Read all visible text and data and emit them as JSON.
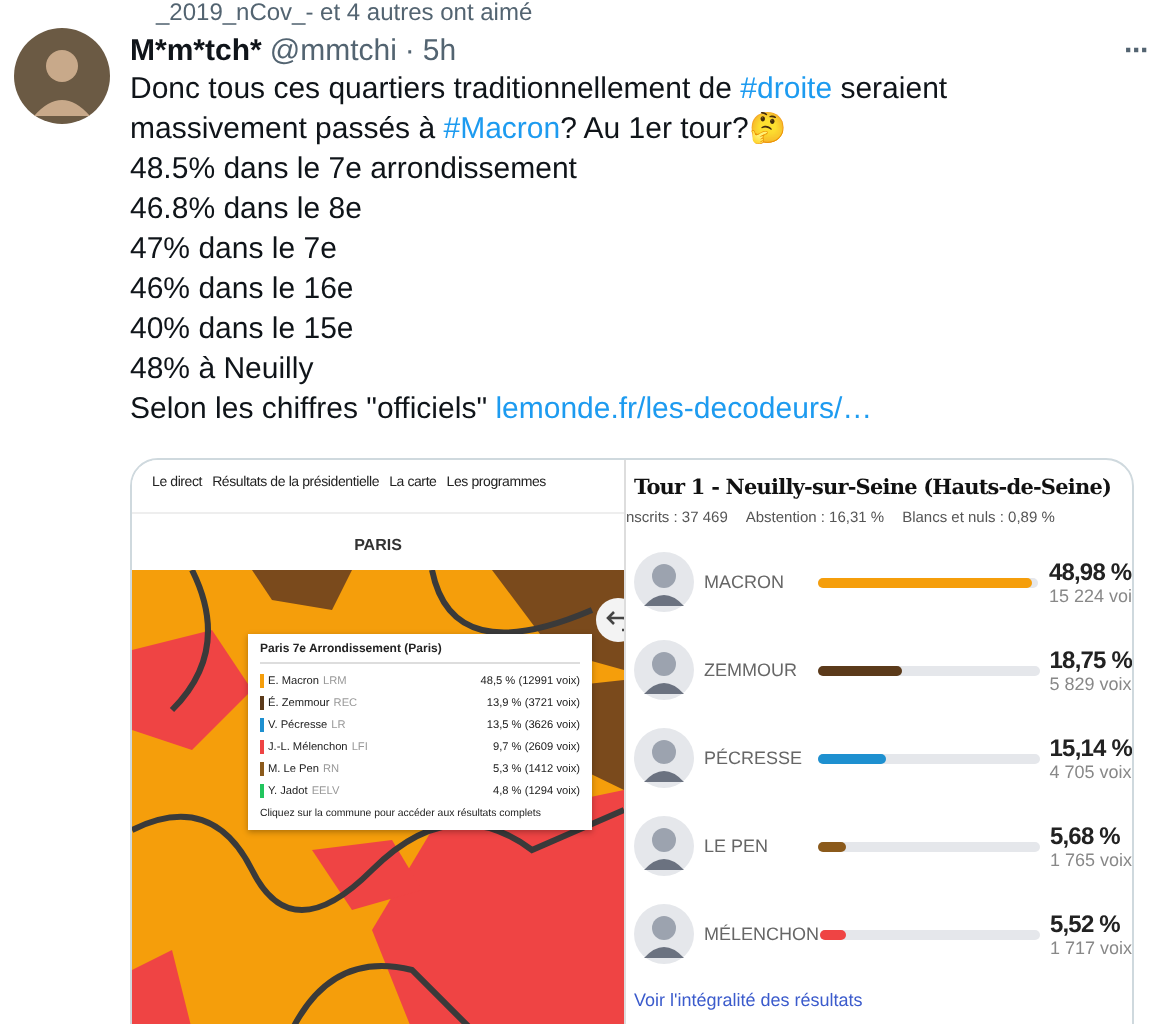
{
  "social_context": "_2019_nCov_- et 4 autres ont aimé",
  "tweet": {
    "name": "M*m*tch*",
    "handle": "@mmtchi",
    "dot": "·",
    "time": "5h",
    "more": "···",
    "lines": [
      [
        {
          "kind": "text",
          "text": "Donc tous ces quartiers traditionnellement de "
        },
        {
          "kind": "link",
          "text": "#droite"
        },
        {
          "kind": "text",
          "text": " seraient"
        }
      ],
      [
        {
          "kind": "text",
          "text": "massivement passés à "
        },
        {
          "kind": "link",
          "text": "#Macron"
        },
        {
          "kind": "text",
          "text": "? Au 1er tour?🤔"
        }
      ],
      [
        {
          "kind": "text",
          "text": "48.5% dans le 7e arrondissement"
        }
      ],
      [
        {
          "kind": "text",
          "text": "46.8% dans le 8e"
        }
      ],
      [
        {
          "kind": "text",
          "text": "47% dans le 7e"
        }
      ],
      [
        {
          "kind": "text",
          "text": "46% dans le 16e"
        }
      ],
      [
        {
          "kind": "text",
          "text": "40% dans le 15e"
        }
      ],
      [
        {
          "kind": "text",
          "text": "48% à Neuilly"
        }
      ],
      [
        {
          "kind": "text",
          "text": "Selon les chiffres \"officiels\" "
        },
        {
          "kind": "link",
          "text": "lemonde.fr/les-decodeurs/…"
        }
      ]
    ]
  },
  "map_panel": {
    "nav": [
      "Le direct",
      "Résultats de la présidentielle",
      "La carte",
      "Les programmes"
    ],
    "heading": "PARIS",
    "tooltip": {
      "title": "Paris 7e Arrondissement (Paris)",
      "footer": "Cliquez sur la commune pour accéder aux résultats complets",
      "rows": [
        {
          "name": "E. Macron",
          "party": "LRM",
          "result": "48,5 % (12991 voix)",
          "color": "#f59e0b"
        },
        {
          "name": "É. Zemmour",
          "party": "REC",
          "result": "13,9 % (3721 voix)",
          "color": "#5b3a1a"
        },
        {
          "name": "V. Pécresse",
          "party": "LR",
          "result": "13,5 % (3626 voix)",
          "color": "#1e90d0"
        },
        {
          "name": "J.-L. Mélenchon",
          "party": "LFI",
          "result": "9,7 % (2609 voix)",
          "color": "#ef4444"
        },
        {
          "name": "M. Le Pen",
          "party": "RN",
          "result": "5,3 % (1412 voix)",
          "color": "#8b5a1b"
        },
        {
          "name": "Y. Jadot",
          "party": "EELV",
          "result": "4,8 % (1294 voix)",
          "color": "#22c55e"
        }
      ]
    }
  },
  "results_panel": {
    "title": "Tour 1 - Neuilly-sur-Seine (Hauts-de-Seine)",
    "stats": [
      "nscrits : 37 469",
      "Abstention : 16,31 %",
      "Blancs et nuls : 0,89 %"
    ],
    "candidates": [
      {
        "name": "MACRON",
        "level": 0.97,
        "percent": "48,98 %",
        "votes": "15 224 voi",
        "color": "#f59e0b"
      },
      {
        "name": "ZEMMOUR",
        "level": 0.38,
        "percent": "18,75 %",
        "votes": "5 829 voix",
        "color": "#5b3a1a"
      },
      {
        "name": "PÉCRESSE",
        "level": 0.31,
        "percent": "15,14 %",
        "votes": "4 705 voix",
        "color": "#1e90d0"
      },
      {
        "name": "LE PEN",
        "level": 0.12,
        "percent": "5,68 %",
        "votes": "1 765 voix",
        "color": "#8b5a1b"
      },
      {
        "name": "MÉLENCHON",
        "level": 0.12,
        "percent": "5,52 %",
        "votes": "1 717 voix",
        "color": "#ef4444"
      }
    ],
    "link": "Voir l'intégralité des résultats"
  }
}
